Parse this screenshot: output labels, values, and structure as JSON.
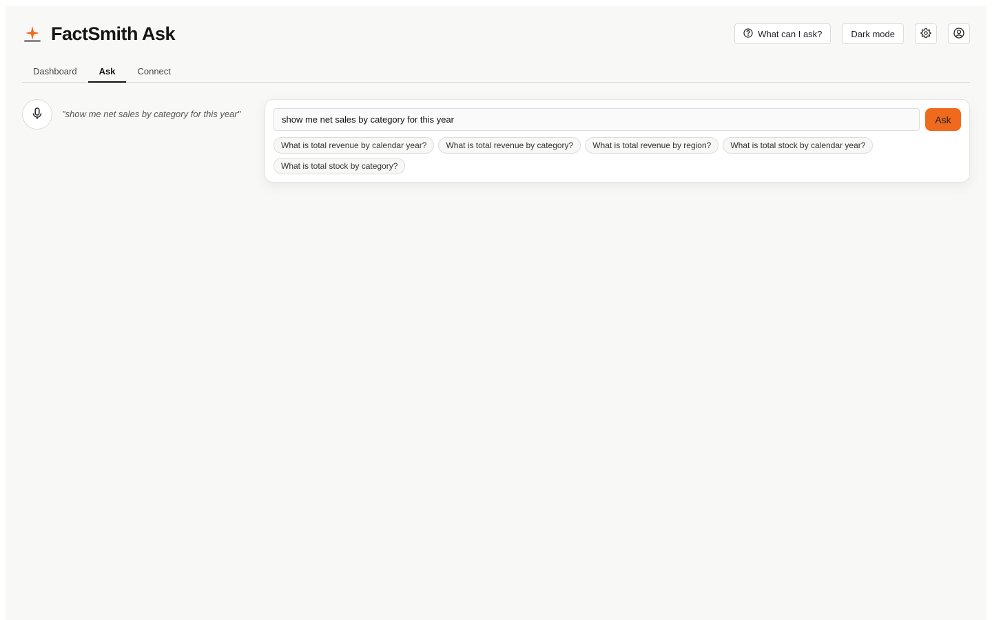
{
  "header": {
    "app_title": "FactSmith Ask",
    "help_button_label": "What can I ask?",
    "dark_mode_label": "Dark mode"
  },
  "tabs": [
    {
      "label": "Dashboard",
      "active": false
    },
    {
      "label": "Ask",
      "active": true
    },
    {
      "label": "Connect",
      "active": false
    }
  ],
  "voice": {
    "transcript": "\"show me net sales by category for this year\""
  },
  "ask": {
    "query_value": "show me net sales by category for this year",
    "button_label": "Ask",
    "suggestions": [
      "What is total revenue by calendar year?",
      "What is total revenue by category?",
      "What is total revenue by region?",
      "What is total stock by calendar year?",
      "What is total stock by category?"
    ]
  },
  "colors": {
    "accent": "#f06a1e",
    "background": "#f8f8f6"
  },
  "icons": [
    "logo-icon",
    "help-circle-icon",
    "gear-icon",
    "user-circle-icon",
    "microphone-icon"
  ]
}
